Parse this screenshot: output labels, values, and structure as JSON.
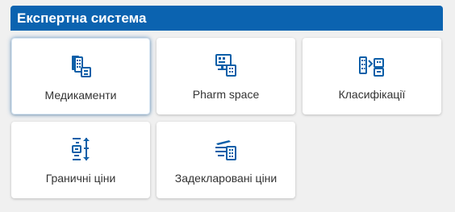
{
  "panel": {
    "title": "Експертна система"
  },
  "tiles": [
    {
      "label": "Медикаменти",
      "icon": "medicines-icon"
    },
    {
      "label": "Pharm space",
      "icon": "pharm-space-icon"
    },
    {
      "label": "Класифікації",
      "icon": "classification-icon"
    },
    {
      "label": "Граничні ціни",
      "icon": "price-limits-icon"
    },
    {
      "label": "Задекларовані ціни",
      "icon": "declared-prices-icon"
    }
  ],
  "colors": {
    "accent": "#0b63b0",
    "icon": "#0d5fa8",
    "background": "#f0f0f0",
    "tile": "#ffffff",
    "text": "#333333"
  }
}
